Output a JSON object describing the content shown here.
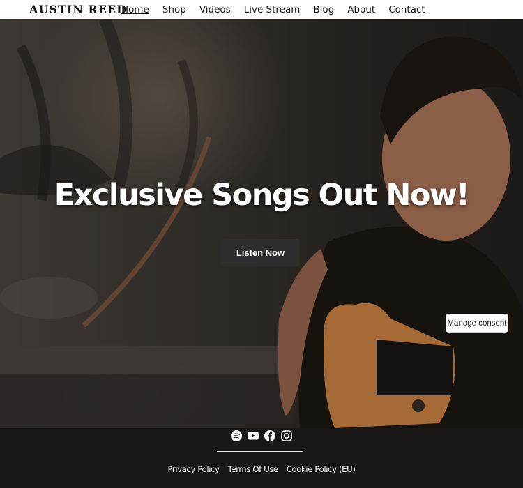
{
  "site": {
    "logo": "AUSTIN REED"
  },
  "nav": {
    "items": [
      {
        "label": "Home",
        "active": true
      },
      {
        "label": "Shop"
      },
      {
        "label": "Videos"
      },
      {
        "label": "Live Stream"
      },
      {
        "label": "Blog"
      },
      {
        "label": "About"
      },
      {
        "label": "Contact"
      }
    ]
  },
  "hero": {
    "title": "Exclusive Songs Out Now!",
    "cta_label": "Listen Now"
  },
  "consent": {
    "label": "Manage consent"
  },
  "footer": {
    "social": [
      "spotify-icon",
      "youtube-icon",
      "facebook-icon",
      "instagram-icon"
    ],
    "links": [
      "Privacy Policy",
      "Terms Of Use",
      "Cookie Policy (EU)"
    ]
  },
  "colors": {
    "nav_bg": "#ffffff",
    "footer_bg": "#1a1817",
    "button_bg": "#2e2d2e",
    "text_light": "#ffffff"
  }
}
